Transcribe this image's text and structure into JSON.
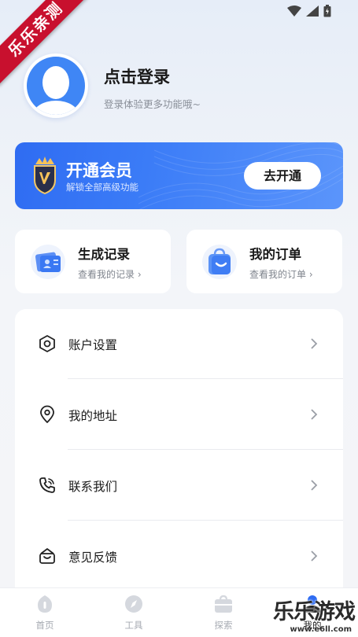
{
  "corner_ribbon": "乐乐亲测",
  "status_bar": {
    "icons": [
      "wifi-icon",
      "signal-icon",
      "battery-icon"
    ]
  },
  "profile": {
    "title": "点击登录",
    "subtitle": "登录体验更多功能哦~"
  },
  "vip": {
    "title": "开通会员",
    "subtitle": "解锁全部高级功能",
    "button": "去开通",
    "accent": "#3575f5"
  },
  "quick": [
    {
      "title": "生成记录",
      "sub": "查看我的记录 ›",
      "icon": "record-card-icon"
    },
    {
      "title": "我的订单",
      "sub": "查看我的订单 ›",
      "icon": "shopping-bag-icon"
    }
  ],
  "menu": [
    {
      "label": "账户设置",
      "icon": "settings-hex-icon"
    },
    {
      "label": "我的地址",
      "icon": "location-pin-icon"
    },
    {
      "label": "联系我们",
      "icon": "phone-icon"
    },
    {
      "label": "意见反馈",
      "icon": "feedback-mail-icon"
    }
  ],
  "tabs": [
    {
      "label": "首页",
      "icon": "home-icon"
    },
    {
      "label": "工具",
      "icon": "compass-icon"
    },
    {
      "label": "探索",
      "icon": "bag-icon"
    },
    {
      "label": "我的",
      "icon": "profile-icon"
    }
  ],
  "watermark": {
    "text": "乐乐游戏",
    "url": "www.e6ll.com"
  }
}
